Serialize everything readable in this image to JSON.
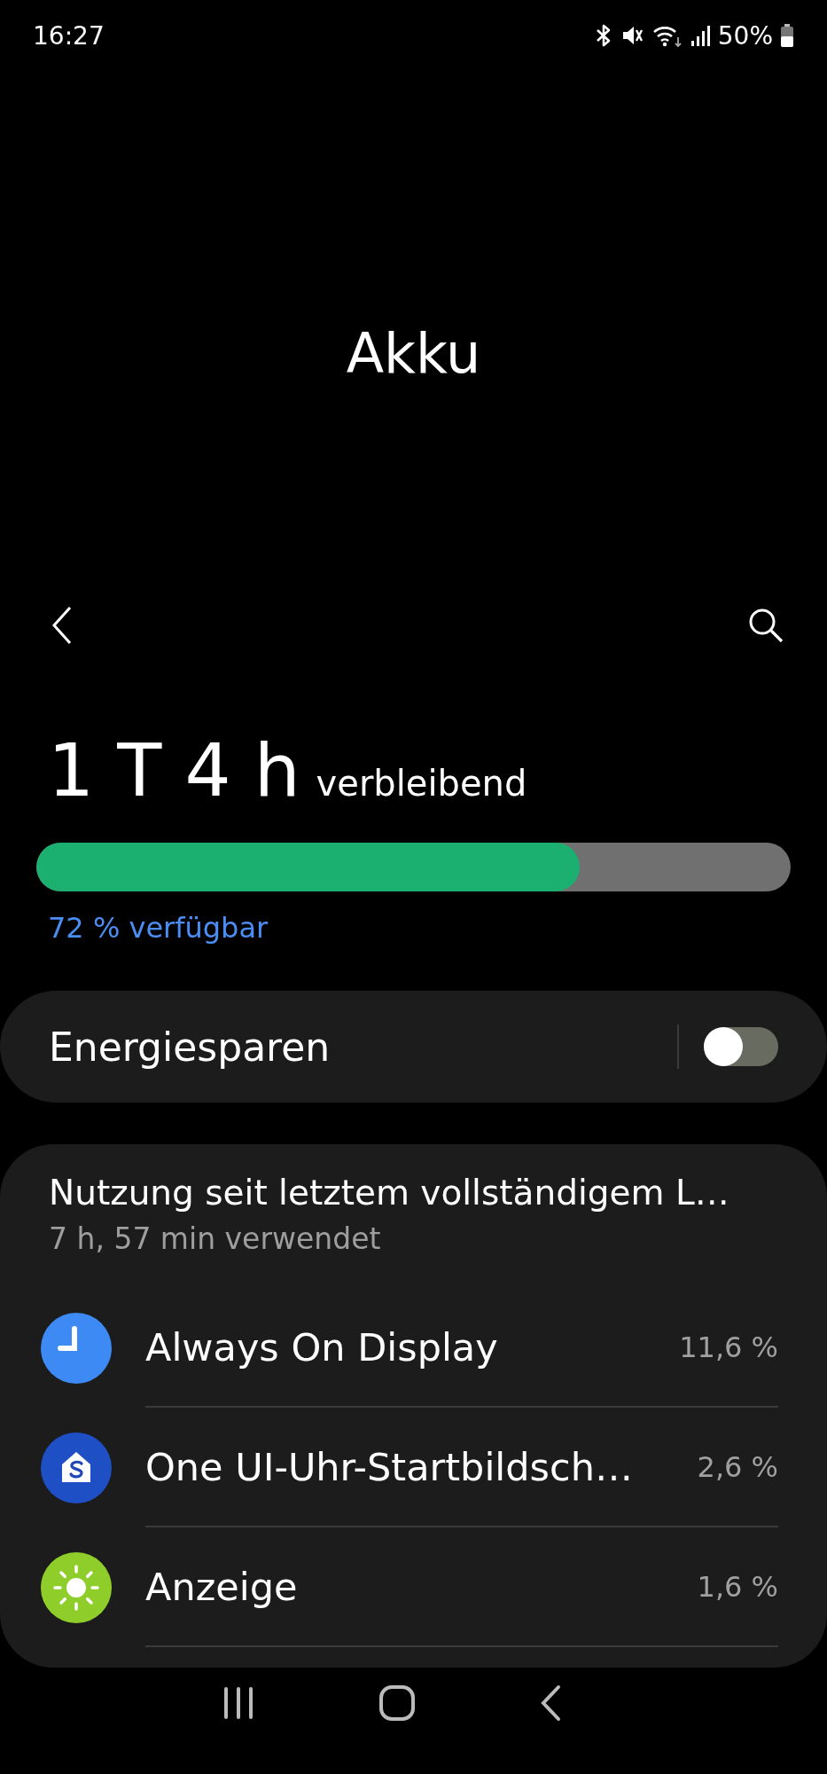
{
  "status_bar": {
    "time": "16:27",
    "battery": "50%"
  },
  "title": "Akku",
  "remaining": {
    "value": "1 T 4 h",
    "label": "verbleibend"
  },
  "battery_bar": {
    "level": 0.72,
    "reading": "72 % verfügbar"
  },
  "power_saving": {
    "label": "Energiesparen",
    "on": false
  },
  "usage": {
    "title": "Nutzung seit letztem vollständigem L…",
    "subtitle": "7 h, 57 min verwendet",
    "apps": [
      {
        "kind": "clock",
        "name": "Always On Display",
        "percent": "11,6 %"
      },
      {
        "kind": "home",
        "name": "One UI-Uhr-Startbildsch…",
        "percent": "2,6 %"
      },
      {
        "kind": "sun",
        "name": "Anzeige",
        "percent": "1,6 %"
      }
    ]
  }
}
